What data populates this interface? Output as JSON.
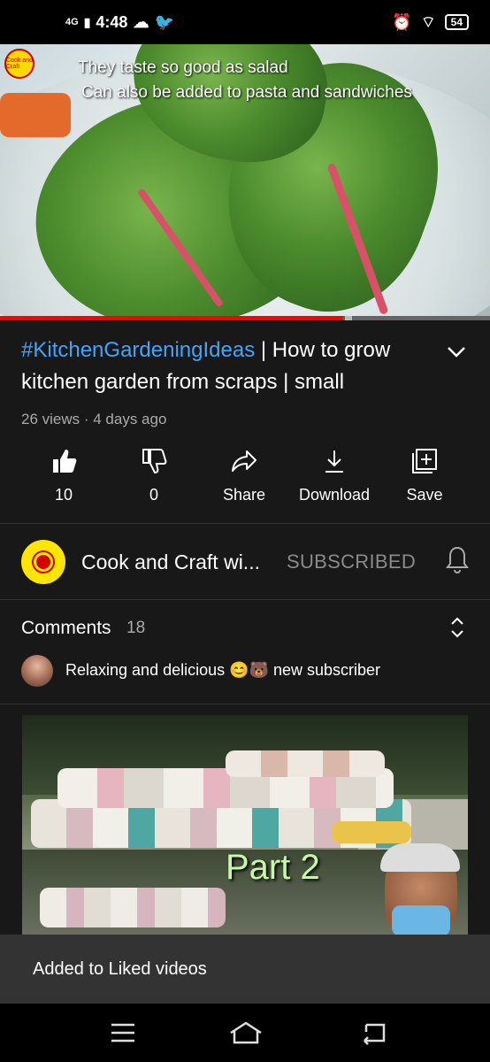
{
  "status_bar": {
    "time": "4:48",
    "network": "4G",
    "battery": "54"
  },
  "video": {
    "caption_line1": "They taste so good as salad",
    "caption_line2": "Can also be added to pasta and sandwiches",
    "watermark": "Cook and Craft",
    "progress": 0.7
  },
  "title": {
    "hashtag": "#KitchenGardeningIdeas",
    "separator": " | ",
    "text": "How to grow kitchen garden from scraps | small"
  },
  "meta": {
    "views_age": "26 views · 4 days ago"
  },
  "actions": {
    "like_count": "10",
    "dislike_count": "0",
    "share": "Share",
    "download": "Download",
    "save": "Save"
  },
  "channel": {
    "name": "Cook and Craft wi...",
    "subscribe_state": "SUBSCRIBED"
  },
  "comments": {
    "label": "Comments",
    "count": "18",
    "top_comment": "Relaxing and delicious 😊🐻 new subscriber"
  },
  "next_video": {
    "overlay_text": "Part 2"
  },
  "toast": {
    "message": "Added to Liked videos"
  },
  "colors": {
    "accent_blue": "#3ea6ff",
    "progress_red": "#ff0000",
    "background": "#181818"
  }
}
